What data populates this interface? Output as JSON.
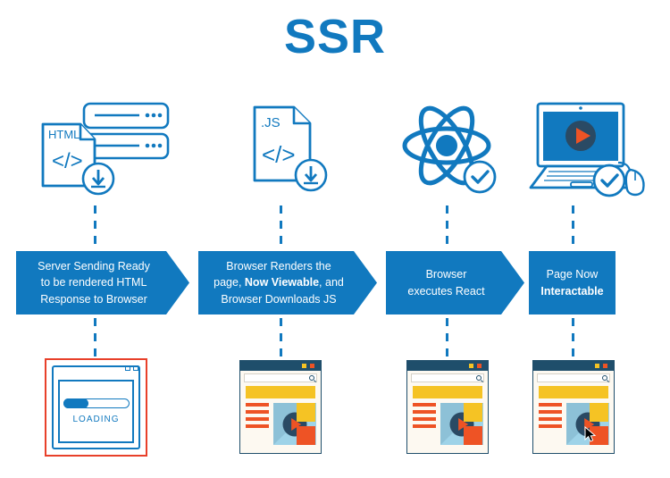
{
  "title": "SSR",
  "theme": {
    "brand_blue": "#1179bf",
    "alert_red": "#e8402a",
    "mock_navy": "#1f4e6b",
    "mock_yellow": "#f5c324",
    "mock_orange": "#ee5325",
    "mock_lightblue": "#9ed3e8",
    "mock_bg": "#fdf9f1"
  },
  "icons": [
    {
      "name": "html-file-download-server-icon",
      "file_label": "HTML",
      "code_glyph": "</>"
    },
    {
      "name": "js-file-download-icon",
      "file_label": ".JS",
      "code_glyph": "</>"
    },
    {
      "name": "react-atom-check-icon",
      "file_label": "",
      "code_glyph": ""
    },
    {
      "name": "laptop-mouse-check-icon",
      "file_label": "",
      "code_glyph": ""
    }
  ],
  "steps": [
    {
      "id": "step-1",
      "shape": "arrow",
      "lines": [
        {
          "text": "Server Sending Ready",
          "bold": false
        },
        {
          "text": "to be rendered HTML",
          "bold": false
        },
        {
          "text": "Response to Browser",
          "bold": false
        }
      ]
    },
    {
      "id": "step-2",
      "shape": "arrow",
      "lines": [
        {
          "text": "Browser Renders the",
          "bold": false
        },
        {
          "text": "page, ",
          "bold_part": "Now Viewable",
          "text_after": ", and",
          "bold": false
        },
        {
          "text": "Browser Downloads JS",
          "bold": false
        }
      ]
    },
    {
      "id": "step-3",
      "shape": "arrow",
      "lines": [
        {
          "text": "Browser",
          "bold": false
        },
        {
          "text": "executes React",
          "bold": false
        }
      ]
    },
    {
      "id": "step-4",
      "shape": "rect",
      "lines": [
        {
          "text": "Page Now",
          "bold": false
        },
        {
          "text": "Interactable",
          "bold": true
        }
      ]
    }
  ],
  "step_text": {
    "s1l1": "Server Sending Ready",
    "s1l2": "to be rendered HTML",
    "s1l3": "Response to Browser",
    "s2l1": "Browser Renders the",
    "s2l2a": "page, ",
    "s2l2b": "Now Viewable",
    "s2l2c": ", and",
    "s2l3": "Browser Downloads JS",
    "s3l1": "Browser",
    "s3l2": "executes React",
    "s4l1": "Page Now",
    "s4l2": "Interactable"
  },
  "results": [
    {
      "id": "result-1",
      "type": "loading-browser",
      "label": "LOADING",
      "highlighted": true,
      "progress_percent": 38,
      "has_cursor": false
    },
    {
      "id": "result-2",
      "type": "website-mockup",
      "label": "",
      "highlighted": false,
      "has_cursor": false
    },
    {
      "id": "result-3",
      "type": "website-mockup",
      "label": "",
      "highlighted": false,
      "has_cursor": false
    },
    {
      "id": "result-4",
      "type": "website-mockup",
      "label": "",
      "highlighted": false,
      "has_cursor": true
    }
  ],
  "loading": {
    "label": "LOADING"
  }
}
